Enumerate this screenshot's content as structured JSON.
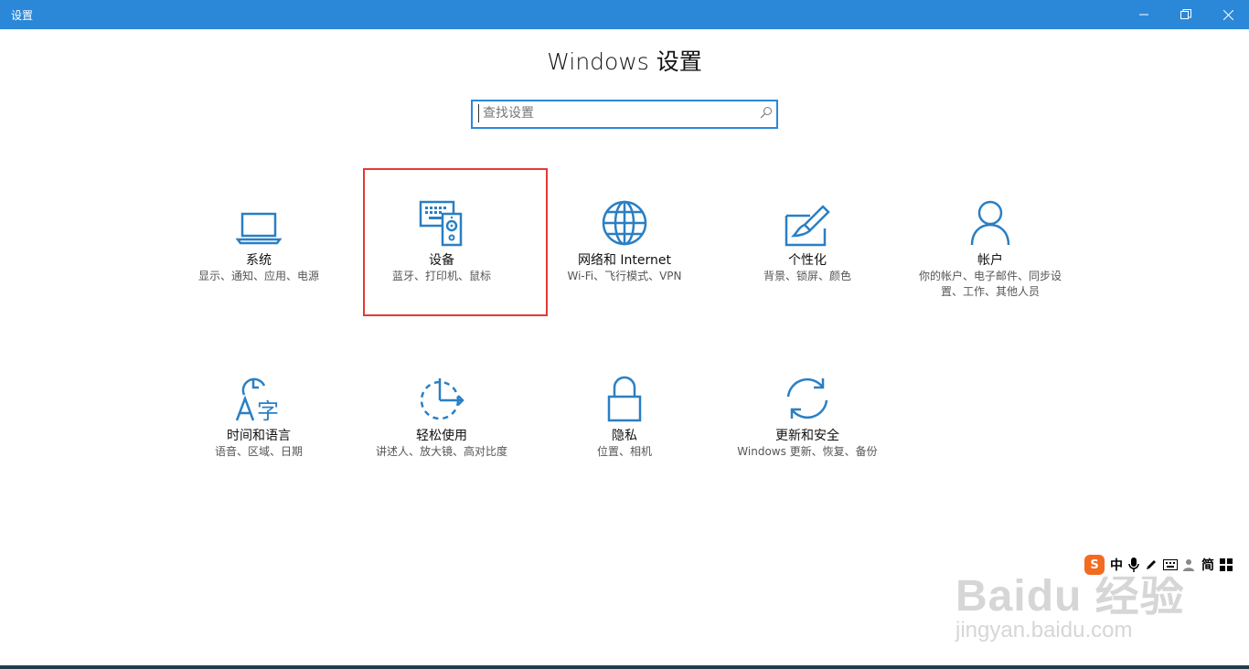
{
  "window": {
    "title": "设置",
    "controls": {
      "minimize": "minimize-icon",
      "restore": "restore-icon",
      "close": "close-icon"
    }
  },
  "page_title": "Windows 设置",
  "search": {
    "placeholder": "查找设置",
    "value": ""
  },
  "tiles": [
    {
      "name": "系统",
      "desc": "显示、通知、应用、电源",
      "icon": "laptop-icon"
    },
    {
      "name": "设备",
      "desc": "蓝牙、打印机、鼠标",
      "icon": "devices-icon",
      "highlighted": true
    },
    {
      "name": "网络和 Internet",
      "desc": "Wi-Fi、飞行模式、VPN",
      "icon": "globe-icon"
    },
    {
      "name": "个性化",
      "desc": "背景、锁屏、颜色",
      "icon": "personalization-icon"
    },
    {
      "name": "帐户",
      "desc": "你的帐户、电子邮件、同步设置、工作、其他人员",
      "icon": "person-icon"
    },
    {
      "name": "时间和语言",
      "desc": "语音、区域、日期",
      "icon": "time-language-icon"
    },
    {
      "name": "轻松使用",
      "desc": "讲述人、放大镜、高对比度",
      "icon": "ease-of-access-icon"
    },
    {
      "name": "隐私",
      "desc": "位置、相机",
      "icon": "lock-icon"
    },
    {
      "name": "更新和安全",
      "desc": "Windows 更新、恢复、备份",
      "icon": "sync-icon"
    }
  ],
  "ime_toolbar": {
    "logo": "S",
    "items": [
      "中",
      "简"
    ]
  },
  "watermark": {
    "main": "Baidu 经验",
    "sub": "jingyan.baidu.com"
  },
  "colors": {
    "accent": "#2b88d8",
    "highlight": "#e53935",
    "icon": "#2a7fc4"
  }
}
